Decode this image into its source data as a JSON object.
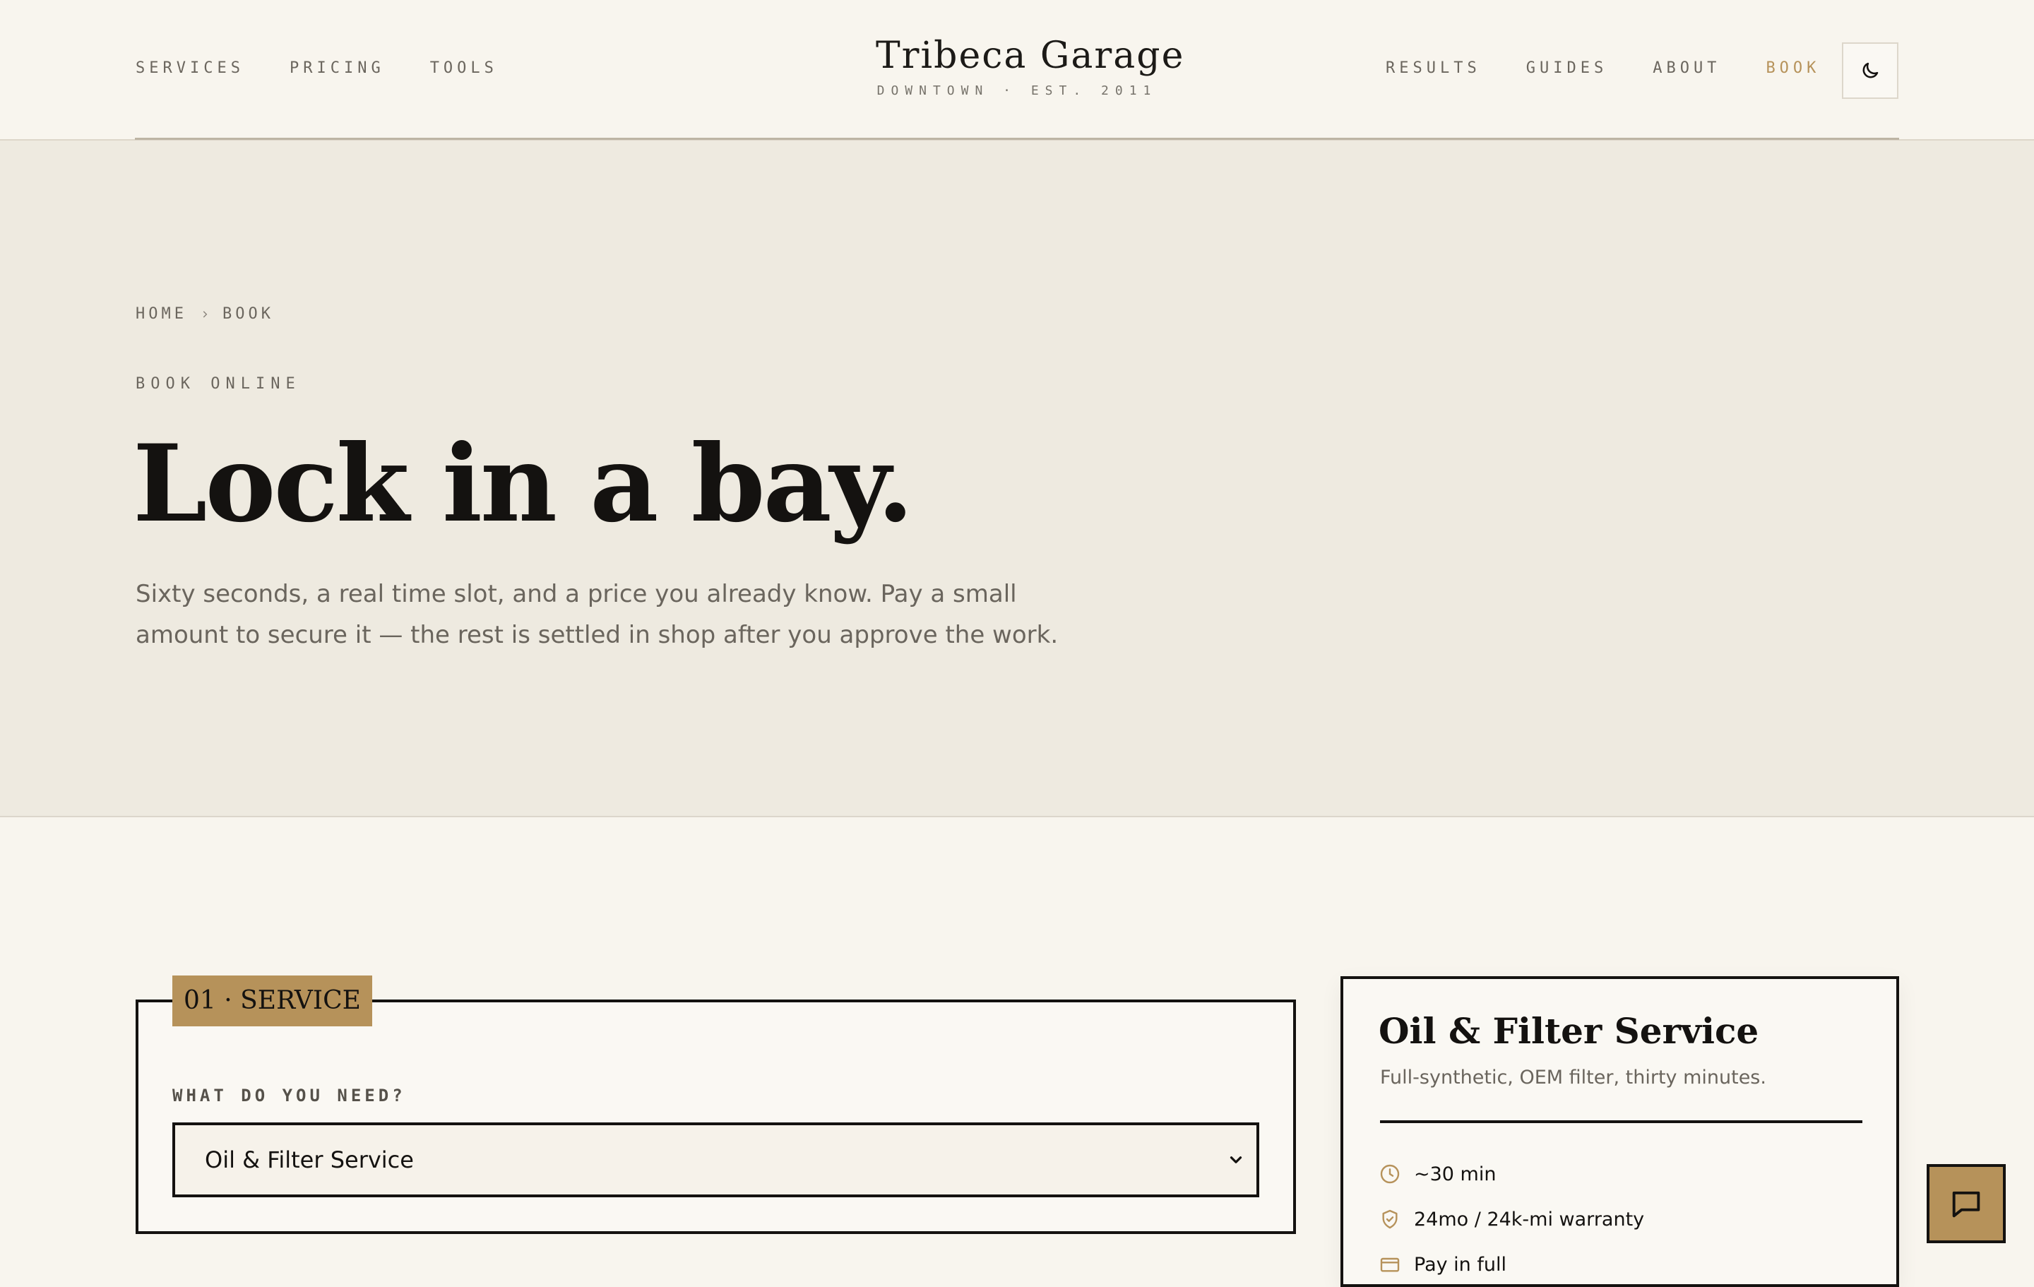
{
  "header": {
    "nav_left": [
      {
        "label": "SERVICES"
      },
      {
        "label": "PRICING"
      },
      {
        "label": "TOOLS"
      }
    ],
    "brand": {
      "name": "Tribeca Garage",
      "tagline": "DOWNTOWN · EST. 2011"
    },
    "nav_right": [
      {
        "label": "RESULTS"
      },
      {
        "label": "GUIDES"
      },
      {
        "label": "ABOUT"
      },
      {
        "label": "BOOK",
        "active": true
      }
    ],
    "theme_toggle_icon": "moon-icon"
  },
  "hero": {
    "breadcrumb": [
      "HOME",
      "BOOK"
    ],
    "eyebrow": "BOOK ONLINE",
    "title": "Lock in a bay.",
    "subtitle": "Sixty seconds, a real time slot, and a price you already know. Pay a small amount to secure it — the rest is settled in shop after you approve the work."
  },
  "service_step": {
    "tag": "01 · SERVICE",
    "field_label": "WHAT DO YOU NEED?",
    "selected": "Oil & Filter Service"
  },
  "summary": {
    "title": "Oil & Filter Service",
    "subtitle": "Full-synthetic, OEM filter, thirty minutes.",
    "items": [
      {
        "icon": "clock-icon",
        "label": "~30 min"
      },
      {
        "icon": "shield-check-icon",
        "label": "24mo / 24k-mi warranty"
      },
      {
        "icon": "credit-card-icon",
        "label": "Pay in full"
      }
    ]
  },
  "chat": {
    "icon": "chat-bubble-icon"
  },
  "colors": {
    "accent": "#b6925a",
    "ink": "#141210",
    "page_bg": "#f8f5ee",
    "hero_bg": "#eeeae0"
  }
}
